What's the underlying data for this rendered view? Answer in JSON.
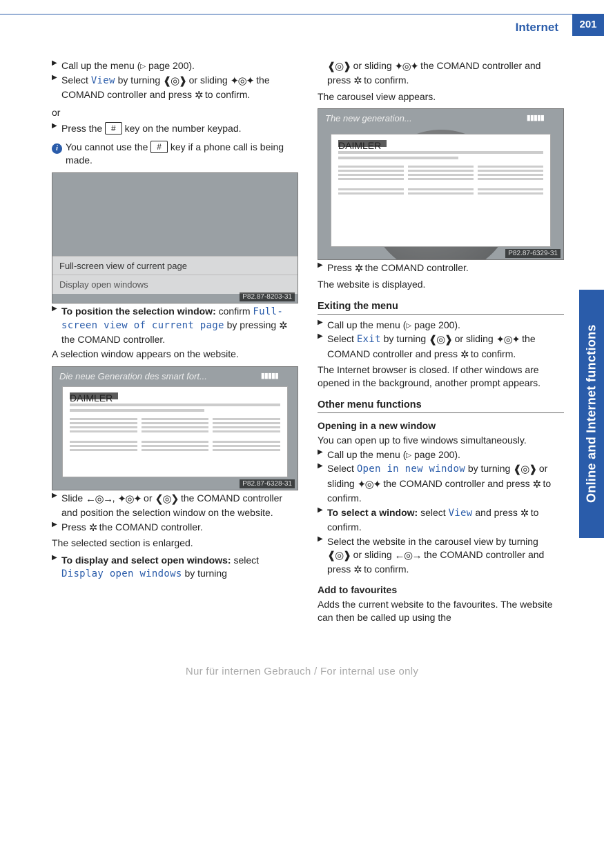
{
  "page": {
    "header": "Internet",
    "number": "201",
    "side_tab": "Online and Internet functions",
    "footer": "Nur für internen Gebrauch / For internal use only"
  },
  "keys": {
    "hash": "#"
  },
  "icons": {
    "info": "i",
    "step_marker": "▶",
    "page_ref_marker": "▷",
    "rotate": "❰◎❱",
    "slide_v": "✦◎✦",
    "press": "✲",
    "slide_h": "←◎→",
    "rotate_diag": "❮◎❯"
  },
  "left": {
    "s1": {
      "a": "Call up the menu (",
      "b": " page 200)."
    },
    "s2": {
      "a": "Select ",
      "cmd": "View",
      "b": " by turning ",
      "c": " or sliding ",
      "d": " the COMAND controller and press ",
      "e": " to confirm."
    },
    "or": "or",
    "s3": {
      "a": "Press the ",
      "b": " key on the number keypad."
    },
    "info1": {
      "a": "You cannot use the ",
      "b": " key if a phone call is being made."
    },
    "shot1": {
      "bar1": "Full-screen view of current page",
      "bar2": "Display open windows",
      "label": "P82.87-8203-31"
    },
    "s4": {
      "lead": "To position the selection window:",
      "a": " confirm ",
      "cmd": "Full-screen view of current page",
      "b": " by pressing ",
      "c": " the COMAND controller."
    },
    "s4b": "A selection window appears on the website.",
    "shot2": {
      "title": "Die neue Generation des smart fort...",
      "label": "P82.87-6328-31"
    },
    "s5": {
      "a": "Slide ",
      "b": ", ",
      "c": " or ",
      "d": " the COMAND controller and position the selection window on the website."
    },
    "s6": {
      "a": "Press ",
      "b": " the COMAND controller."
    },
    "s6b": "The selected section is enlarged.",
    "s7": {
      "lead": "To display and select open windows:",
      "a": " select ",
      "cmd": "Display open windows",
      "b": " by turning"
    }
  },
  "right": {
    "cont": {
      "a": " or sliding ",
      "b": " the COMAND controller and press ",
      "c": " to confirm."
    },
    "contb": "The carousel view appears.",
    "shot3": {
      "title": "The new generation...",
      "label": "P82.87-6329-31"
    },
    "r1": {
      "a": "Press ",
      "b": " the COMAND controller."
    },
    "r1b": "The website is displayed.",
    "h_exit": "Exiting the menu",
    "r2": {
      "a": "Call up the menu (",
      "b": " page 200)."
    },
    "r3": {
      "a": "Select ",
      "cmd": "Exit",
      "b": " by turning ",
      "c": " or sliding ",
      "d": " the COMAND controller and press ",
      "e": " to confirm."
    },
    "r3b": "The Internet browser is closed. If other windows are opened in the background, another prompt appears.",
    "h_other": "Other menu functions",
    "h_open": "Opening in a new window",
    "p_open": "You can open up to five windows simultaneously.",
    "r4": {
      "a": "Call up the menu (",
      "b": " page 200)."
    },
    "r5": {
      "a": "Select ",
      "cmd": "Open in new window",
      "b": " by turning ",
      "c": " or sliding ",
      "d": " the COMAND controller and press ",
      "e": " to confirm."
    },
    "r6": {
      "lead": "To select a window:",
      "a": " select ",
      "cmd": "View",
      "b": " and press ",
      "c": " to confirm."
    },
    "r7": {
      "a": "Select the website in the carousel view by turning ",
      "b": " or sliding ",
      "c": " the COMAND controller and press ",
      "d": " to confirm."
    },
    "h_fav": "Add to favourites",
    "p_fav": "Adds the current website to the favourites. The website can then be called up using the"
  }
}
